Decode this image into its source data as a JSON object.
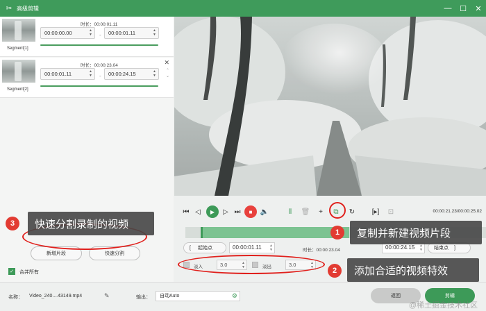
{
  "window": {
    "title": "高级剪辑",
    "controls": [
      "—",
      "☐",
      "✕"
    ]
  },
  "segments": [
    {
      "label": "Segment[1]",
      "duration": "时长：00:00:01.11",
      "start": "00:00:00.00",
      "end": "00:00:01.11"
    },
    {
      "label": "Segment[2]",
      "duration": "时长：00:00:23.04",
      "start": "00:00:01.11",
      "end": "00:00:24.15"
    }
  ],
  "player": {
    "timecode": "00:00:21.23/00:00:25.02"
  },
  "range": {
    "start_button": "起始点",
    "start_value": "00:00:01.11",
    "duration": "时长：00:00:23.04",
    "end_value": "00:00:24.15",
    "end_button": "结束点"
  },
  "effects": {
    "fade_in_label": "淡入",
    "fade_in_value": "3.0",
    "fade_out_label": "淡出",
    "fade_out_value": "3.0"
  },
  "left_buttons": {
    "new_segment": "新增片段",
    "quick_split": "快速分割"
  },
  "merge_all": "合并所有",
  "bottom": {
    "name_label": "名称：",
    "name_value": "Video_240....43149.mp4",
    "output_label": "输出：",
    "output_value": "自动Auto",
    "back_button": "返回",
    "cut_button": "剪辑"
  },
  "annotations": [
    {
      "number": "1",
      "text": "复制并新建视频片段"
    },
    {
      "number": "2",
      "text": "添加合适的视频特效"
    },
    {
      "number": "3",
      "text": "快速分割录制的视频"
    }
  ],
  "watermark": "@稀土掘金技术社区",
  "colors": {
    "accent": "#3d9a58",
    "titlebar": "#3f9b5b",
    "stop": "#e8413d",
    "annotation": "#e0201c"
  }
}
